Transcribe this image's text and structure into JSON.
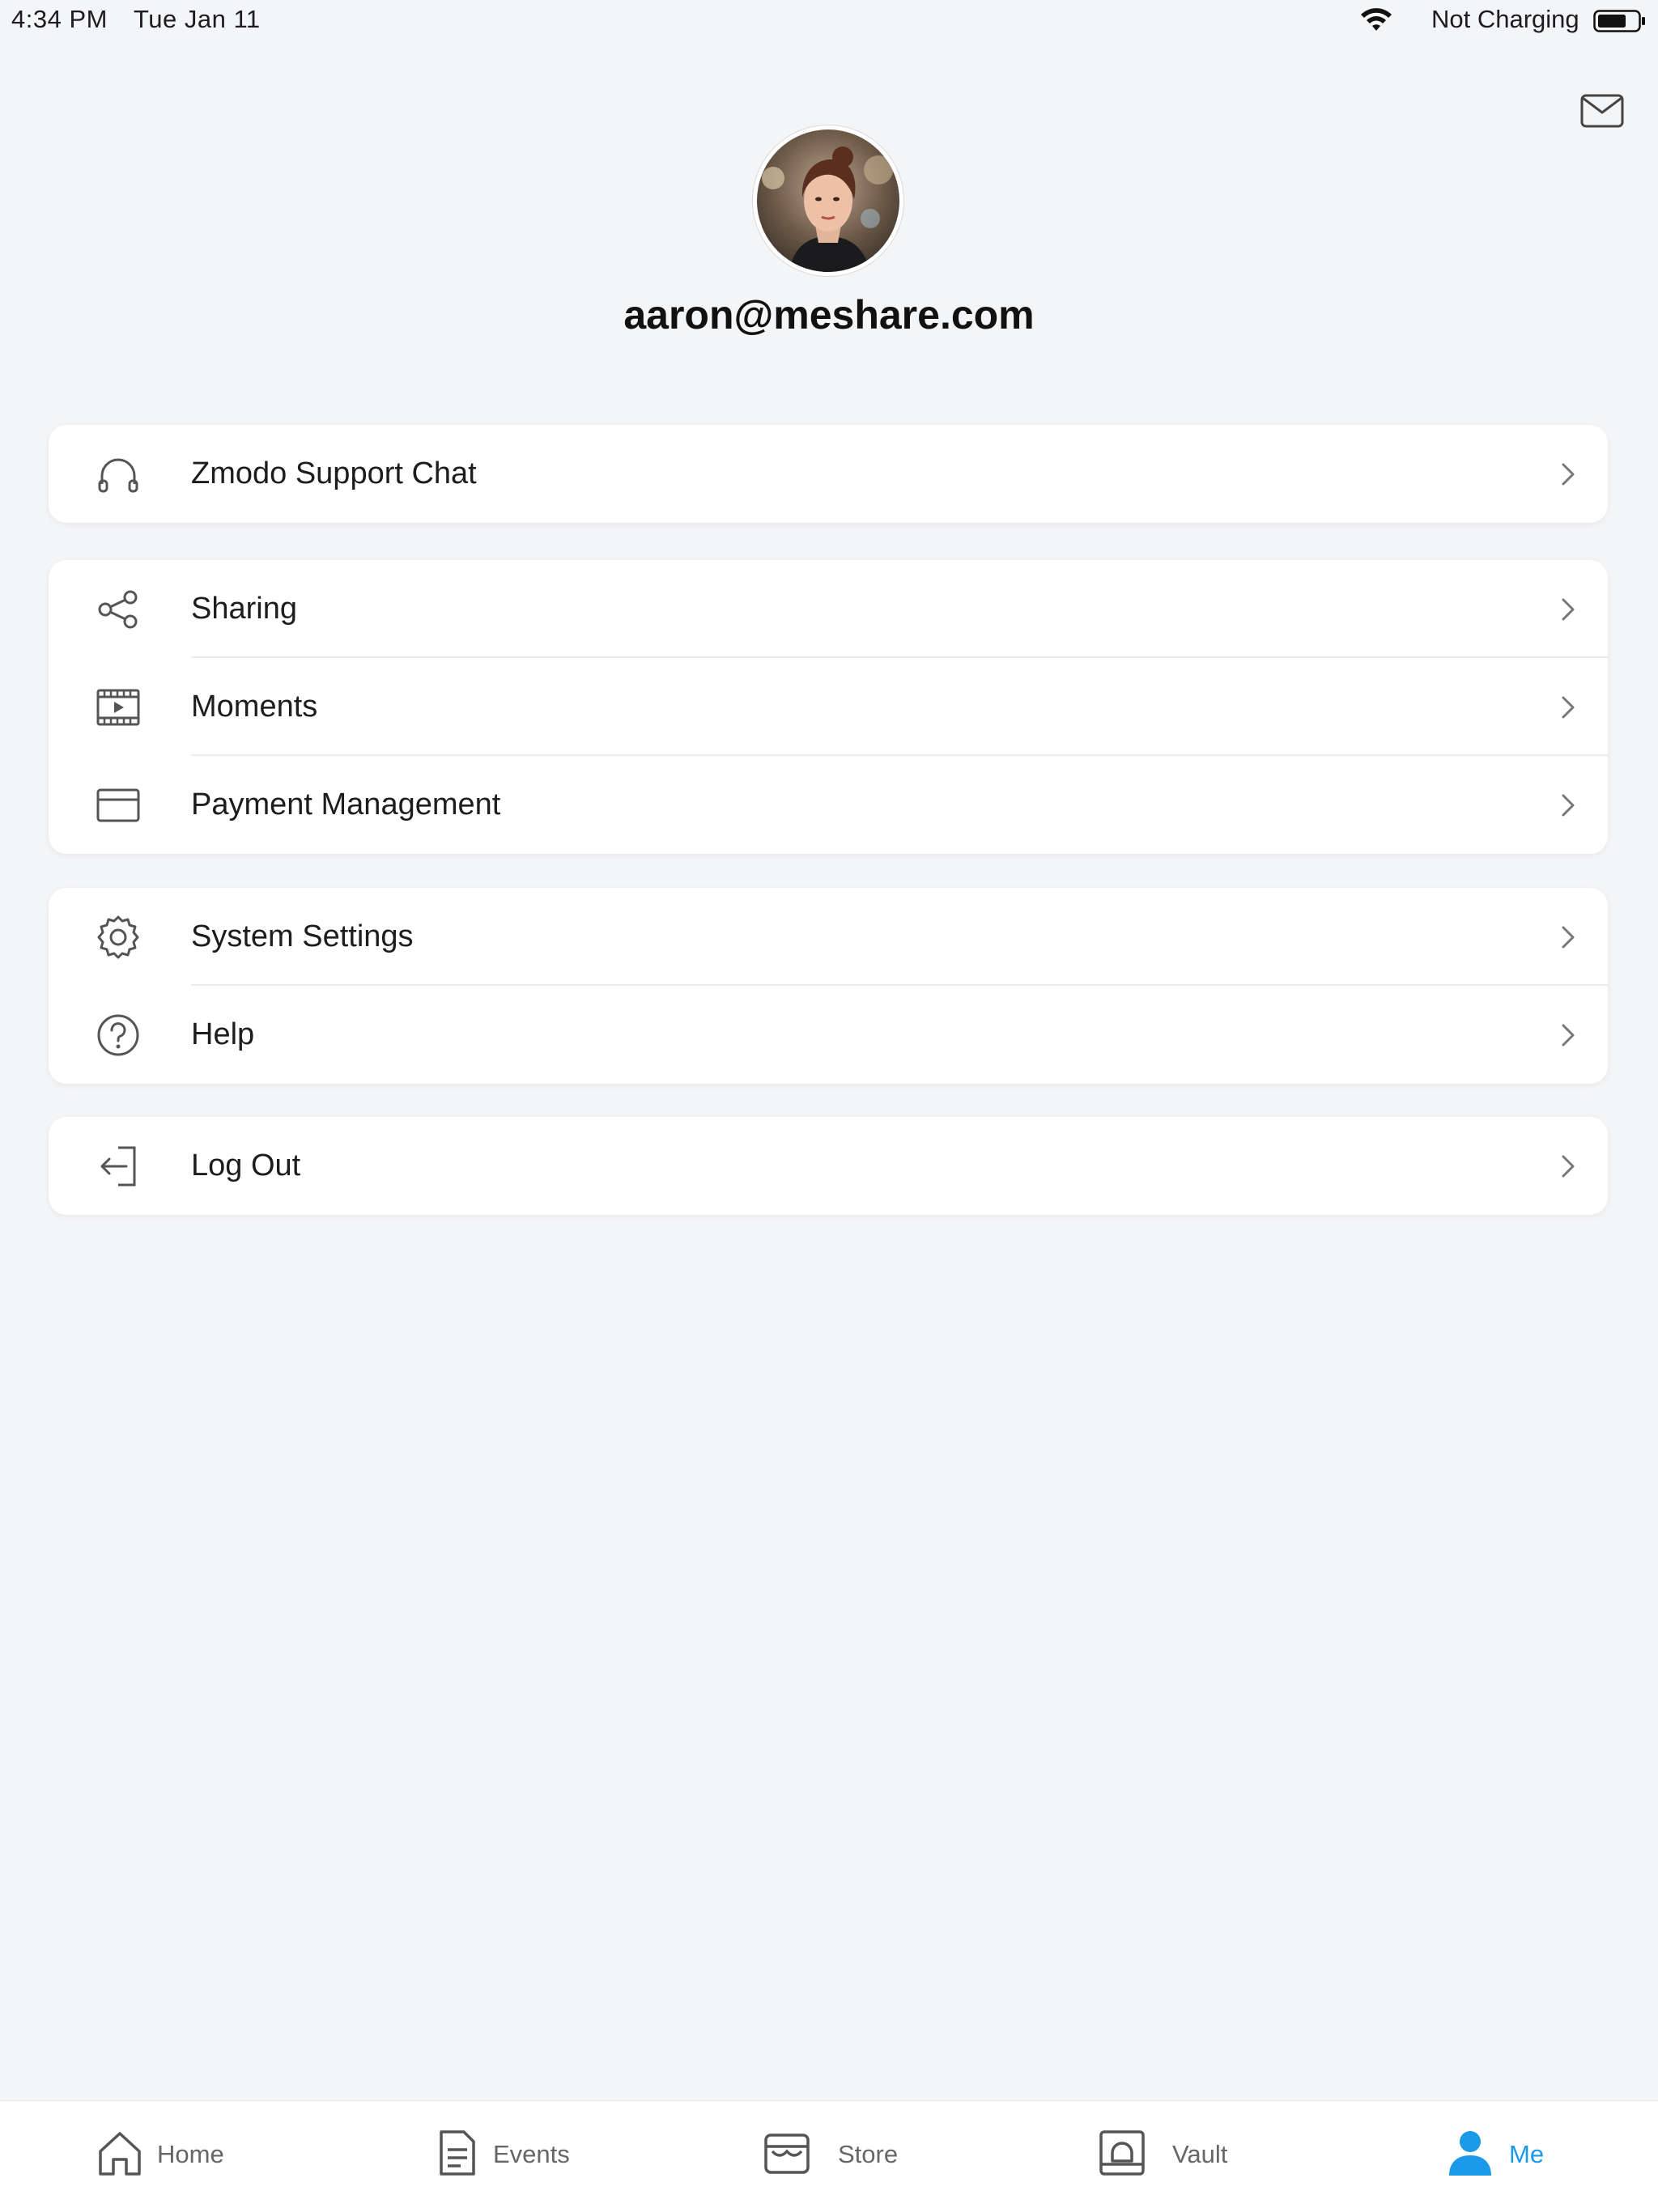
{
  "status_bar": {
    "time": "4:34 PM",
    "date": "Tue Jan 11",
    "charging": "Not Charging",
    "wifi_icon": "wifi-icon",
    "battery_icon": "battery-icon"
  },
  "header": {
    "mail_icon": "mail-icon",
    "avatar_icon": "avatar-photo"
  },
  "profile": {
    "email": "aaron@meshare.com"
  },
  "menu": {
    "support_chat": "Zmodo Support Chat",
    "sharing": "Sharing",
    "moments": "Moments",
    "payment_management": "Payment Management",
    "system_settings": "System Settings",
    "help": "Help",
    "log_out": "Log Out"
  },
  "tabs": {
    "home": "Home",
    "events": "Events",
    "store": "Store",
    "vault": "Vault",
    "me": "Me",
    "active": "Me"
  },
  "colors": {
    "accent": "#1a9ae8",
    "background": "#f4f5f7",
    "card": "#ffffff",
    "icon_gray": "#555555"
  }
}
